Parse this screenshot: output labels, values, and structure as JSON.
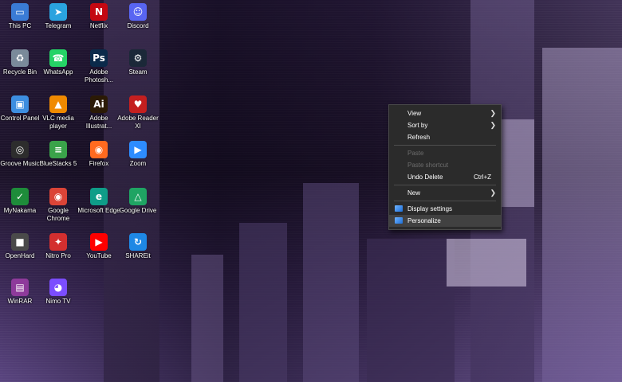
{
  "desktop": {
    "icons": [
      {
        "label": "This PC",
        "glyph": "▭",
        "color": "#3a7bd5",
        "icon": "computer-icon"
      },
      {
        "label": "Telegram",
        "glyph": "➤",
        "color": "#2aa3df",
        "icon": "telegram-icon"
      },
      {
        "label": "Netflix",
        "glyph": "N",
        "color": "#c40812",
        "icon": "netflix-icon"
      },
      {
        "label": "Discord",
        "glyph": "☺",
        "color": "#5865f2",
        "icon": "discord-icon"
      },
      {
        "label": "Recycle Bin",
        "glyph": "♻",
        "color": "#7a8a9a",
        "icon": "recycle-bin-icon"
      },
      {
        "label": "WhatsApp",
        "glyph": "☎",
        "color": "#25d366",
        "icon": "whatsapp-icon"
      },
      {
        "label": "Adobe Photosh...",
        "glyph": "Ps",
        "color": "#0b2a4a",
        "icon": "photoshop-icon"
      },
      {
        "label": "Steam",
        "glyph": "⚙",
        "color": "#1b2838",
        "icon": "steam-icon"
      },
      {
        "label": "Control Panel",
        "glyph": "▣",
        "color": "#3d8ee0",
        "icon": "control-panel-icon"
      },
      {
        "label": "VLC media player",
        "glyph": "▲",
        "color": "#f08a00",
        "icon": "vlc-icon"
      },
      {
        "label": "Adobe Illustrat...",
        "glyph": "Ai",
        "color": "#2b1a05",
        "icon": "illustrator-icon"
      },
      {
        "label": "Adobe Reader XI",
        "glyph": "♥",
        "color": "#c41f1f",
        "icon": "acrobat-reader-icon"
      },
      {
        "label": "Groove Music",
        "glyph": "◎",
        "color": "#2d2d2d",
        "icon": "groove-music-icon"
      },
      {
        "label": "BlueStacks 5",
        "glyph": "≡",
        "color": "#3aa34a",
        "icon": "bluestacks-icon"
      },
      {
        "label": "Firefox",
        "glyph": "◉",
        "color": "#ff6a1f",
        "icon": "firefox-icon"
      },
      {
        "label": "Zoom",
        "glyph": "▶",
        "color": "#2d8cff",
        "icon": "zoom-icon"
      },
      {
        "label": "MyNakama",
        "glyph": "✓",
        "color": "#1e8c3a",
        "icon": "mynakama-icon"
      },
      {
        "label": "Google Chrome",
        "glyph": "◉",
        "color": "#db4437",
        "icon": "chrome-icon"
      },
      {
        "label": "Microsoft Edge",
        "glyph": "e",
        "color": "#0f9d88",
        "icon": "edge-icon"
      },
      {
        "label": "Google Drive",
        "glyph": "△",
        "color": "#1fa463",
        "icon": "google-drive-icon"
      },
      {
        "label": "OpenHard",
        "glyph": "■",
        "color": "#4a4a4a",
        "icon": "openhard-icon"
      },
      {
        "label": "Nitro Pro",
        "glyph": "✦",
        "color": "#d32f2f",
        "icon": "nitro-pro-icon"
      },
      {
        "label": "YouTube",
        "glyph": "▶",
        "color": "#ff0000",
        "icon": "youtube-icon"
      },
      {
        "label": "SHAREit",
        "glyph": "↻",
        "color": "#1e88e5",
        "icon": "shareit-icon"
      },
      {
        "label": "WinRAR",
        "glyph": "▤",
        "color": "#8e3a9b",
        "icon": "winrar-icon"
      },
      {
        "label": "Nimo TV",
        "glyph": "◕",
        "color": "#7b4dff",
        "icon": "nimo-tv-icon"
      }
    ]
  },
  "context_menu": {
    "view": "View",
    "sort_by": "Sort by",
    "refresh": "Refresh",
    "paste": "Paste",
    "paste_shortcut": "Paste shortcut",
    "undo_delete": "Undo Delete",
    "undo_delete_shortcut": "Ctrl+Z",
    "new": "New",
    "display_settings": "Display settings",
    "personalize": "Personalize",
    "submenu_arrow": "❯"
  }
}
